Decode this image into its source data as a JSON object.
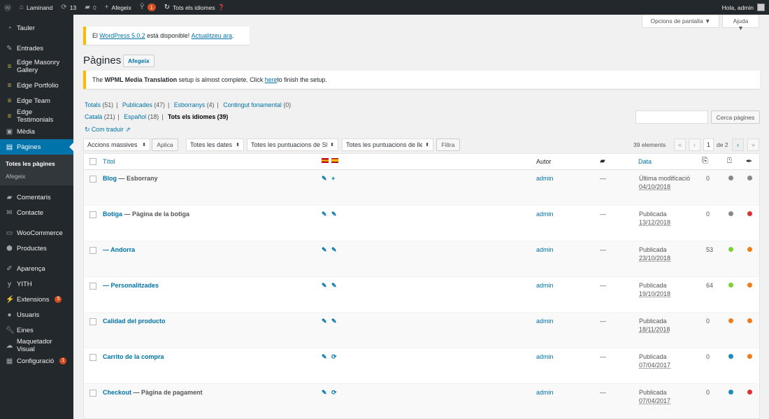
{
  "adminbar": {
    "site_name": "Laminand",
    "updates_count": "13",
    "comments_count": "0",
    "new_label": "Afegeix",
    "yoast_badge": "1",
    "lang_label": "Tots els idiomes",
    "greeting": "Hola, admin"
  },
  "sidebar": {
    "items": [
      {
        "label": "Tauler",
        "icon": "dashboard-icon"
      },
      {
        "label": "Entrades",
        "icon": "pin-icon"
      },
      {
        "label": "Edge Masonry Gallery",
        "icon": "list-icon"
      },
      {
        "label": "Edge Portfolio",
        "icon": "list-icon"
      },
      {
        "label": "Edge Team",
        "icon": "list-icon"
      },
      {
        "label": "Edge Testimonials",
        "icon": "list-icon"
      },
      {
        "label": "Mèdia",
        "icon": "media-icon"
      },
      {
        "label": "Pàgines",
        "icon": "page-icon"
      },
      {
        "label": "Comentaris",
        "icon": "comment-icon"
      },
      {
        "label": "Contacte",
        "icon": "mail-icon"
      },
      {
        "label": "WooCommerce",
        "icon": "woo-icon"
      },
      {
        "label": "Productes",
        "icon": "box-icon"
      },
      {
        "label": "Aparença",
        "icon": "brush-icon"
      },
      {
        "label": "YITH",
        "icon": "yith-icon"
      },
      {
        "label": "Extensions",
        "icon": "plugin-icon",
        "badge": "5"
      },
      {
        "label": "Usuaris",
        "icon": "user-icon"
      },
      {
        "label": "Eines",
        "icon": "wrench-icon"
      },
      {
        "label": "Maquetador Visual",
        "icon": "cloud-icon"
      },
      {
        "label": "Configuració",
        "icon": "settings-icon",
        "badge": "1"
      }
    ],
    "sub": {
      "all_pages": "Totes les pàgines",
      "add_new": "Afegeix"
    }
  },
  "screen_options": {
    "options": "Opcions de pantalla ▼",
    "help": "Ajuda ▼"
  },
  "update_notice": {
    "pre": "El ",
    "link1": "WordPress 5.0.2",
    "mid": " està disponible! ",
    "link2": "Actualitzeu ara",
    "post": "."
  },
  "page": {
    "title": "Pàgines",
    "add_new": "Afegeix"
  },
  "wpml_notice": {
    "pre": "The ",
    "strong": "WPML Media Translation",
    "mid": " setup is almost complete. Click ",
    "link": "here",
    "post": " to finish the setup."
  },
  "filters": {
    "totals": "Totals",
    "totals_c": "(51)",
    "published": "Publicades",
    "published_c": "(47)",
    "drafts": "Esborranys",
    "drafts_c": "(4)",
    "cornerstone": "Contingut fonamental",
    "cornerstone_c": "(0)",
    "catala": "Català",
    "catala_c": "(21)",
    "espanol": "Español",
    "espanol_c": "(18)",
    "all_langs": "Tots els idiomes (39)",
    "how_translate": "Com traduir"
  },
  "search": {
    "button": "Cerca pàgines",
    "placeholder": ""
  },
  "bulk": {
    "actions": "Accions massives",
    "apply": "Aplica",
    "dates": "Totes les dates",
    "seo_scores": "Totes les puntuacions de SEO",
    "read_scores": "Totes les puntuacions de llegibilitat",
    "filter": "Filtra"
  },
  "pagination": {
    "count": "39 elements",
    "first": "«",
    "prev": "‹",
    "current": "1",
    "of": "de 2",
    "next": "›",
    "last": "»"
  },
  "table": {
    "headers": {
      "title": "Títol",
      "author": "Autor",
      "date": "Data"
    },
    "rows": [
      {
        "title": "Blog",
        "state": " — Esborrany",
        "author": "admin",
        "comments": "—",
        "date_status": "Última modificació",
        "date": "04/10/2018",
        "links": "0",
        "seo": "#888888",
        "read": "#888888",
        "t2": "+"
      },
      {
        "title": "Botiga",
        "state": " — Pàgina de la botiga",
        "author": "admin",
        "comments": "—",
        "date_status": "Publicada",
        "date": "13/12/2018",
        "links": "0",
        "seo": "#888888",
        "read": "#dc3232",
        "t2": "✎"
      },
      {
        "title": "— Andorra",
        "state": "",
        "author": "admin",
        "comments": "—",
        "date_status": "Publicada",
        "date": "23/10/2018",
        "links": "53",
        "seo": "#7ad03a",
        "read": "#ee7c1b",
        "t2": "✎"
      },
      {
        "title": "— Personalitzades",
        "state": "",
        "author": "admin",
        "comments": "—",
        "date_status": "Publicada",
        "date": "19/10/2018",
        "links": "64",
        "seo": "#7ad03a",
        "read": "#ee7c1b",
        "t2": "✎"
      },
      {
        "title": "Calidad del producto",
        "state": "",
        "author": "admin",
        "comments": "—",
        "date_status": "Publicada",
        "date": "18/11/2018",
        "links": "0",
        "seo": "#ee7c1b",
        "read": "#ee7c1b",
        "t2": "✎"
      },
      {
        "title": "Carrito de la compra",
        "state": "",
        "author": "admin",
        "comments": "—",
        "date_status": "Publicada",
        "date": "07/04/2017",
        "links": "0",
        "seo": "#1e8cbe",
        "read": "#ee7c1b",
        "t2": "⟳"
      },
      {
        "title": "Checkout",
        "state": " — Pàgina de pagament",
        "author": "admin",
        "comments": "—",
        "date_status": "Publicada",
        "date": "07/04/2017",
        "links": "0",
        "seo": "#1e8cbe",
        "read": "#dc3232",
        "t2": "⟳"
      }
    ]
  }
}
